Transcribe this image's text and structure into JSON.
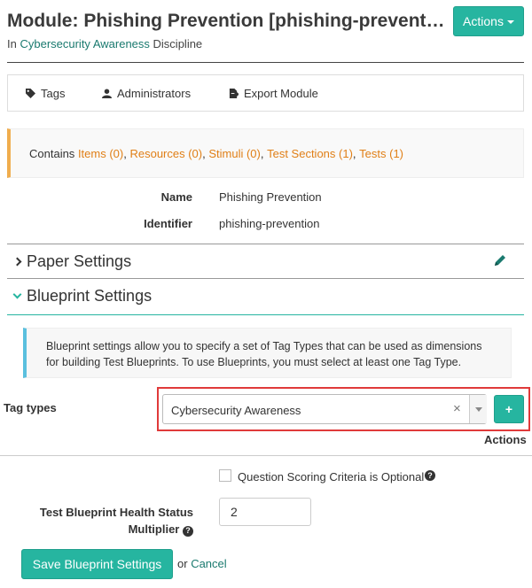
{
  "header": {
    "title": "Module: Phishing Prevention [phishing-preventio...",
    "subtitle_prefix": "In",
    "discipline_link": "Cybersecurity Awareness",
    "subtitle_suffix": "Discipline",
    "actions_label": "Actions"
  },
  "tabs": [
    {
      "label": "Tags",
      "icon": "tag-icon"
    },
    {
      "label": "Administrators",
      "icon": "user-icon"
    },
    {
      "label": "Export Module",
      "icon": "file-export-icon"
    }
  ],
  "contains": {
    "prefix": "Contains",
    "items": [
      "Items (0)",
      "Resources (0)",
      "Stimuli (0)",
      "Test Sections (1)",
      "Tests (1)"
    ]
  },
  "details": {
    "name_label": "Name",
    "name_value": "Phishing Prevention",
    "identifier_label": "Identifier",
    "identifier_value": "phishing-prevention"
  },
  "sections": {
    "paper_settings": "Paper Settings",
    "blueprint_settings": "Blueprint Settings"
  },
  "blueprint": {
    "help_line1": "Blueprint settings allow you to specify a set of Tag Types that can be used as dimensions",
    "help_line2": "for building Test Blueprints. To use Blueprints, you must select at least one Tag Type.",
    "tag_types_label": "Tag types",
    "tag_types_value": "Cybersecurity Awareness",
    "clear_glyph": "×",
    "add_glyph": "+",
    "actions_label": "Actions",
    "scoring_optional_label": "Question Scoring Criteria is Optional",
    "multiplier_label_line1": "Test Blueprint Health Status",
    "multiplier_label_line2": "Multiplier",
    "multiplier_value": "2",
    "save_label": "Save Blueprint Settings",
    "or_text": "or",
    "cancel_label": "Cancel"
  }
}
